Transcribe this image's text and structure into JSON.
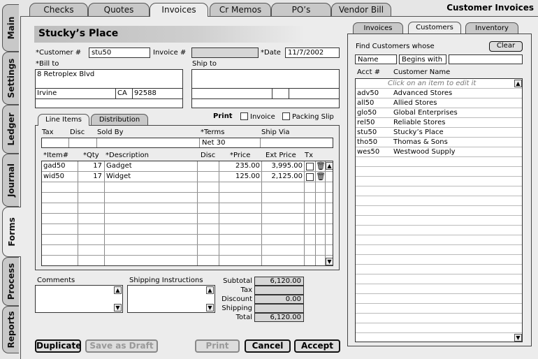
{
  "top_tabs": [
    {
      "label": "Checks"
    },
    {
      "label": "Quotes"
    },
    {
      "label": "Invoices"
    },
    {
      "label": "Cr Memos"
    },
    {
      "label": "PO’s"
    },
    {
      "label": "Vendor Bill"
    }
  ],
  "window_title": "Customer Invoices",
  "side_tabs": [
    {
      "label": "Main"
    },
    {
      "label": "Settings"
    },
    {
      "label": "Ledger"
    },
    {
      "label": "Journal"
    },
    {
      "label": "Forms"
    },
    {
      "label": "Process"
    },
    {
      "label": "Reports"
    }
  ],
  "header": {
    "customer_name": "Stucky’s Place"
  },
  "form": {
    "customer_label": "*Customer #",
    "customer_value": "stu50",
    "invoice_label": "Invoice #",
    "invoice_value": "",
    "date_label": "*Date",
    "date_value": "11/7/2002",
    "bill_to_label": "*Bill to",
    "bill_to": {
      "line1": "8 Retroplex Blvd",
      "city": "Irvine",
      "state": "CA",
      "zip": "92588"
    },
    "ship_to_label": "Ship to"
  },
  "line_tabs": [
    {
      "label": "Line Items"
    },
    {
      "label": "Distribution"
    }
  ],
  "print": {
    "label": "Print",
    "invoice": "Invoice",
    "packing_slip": "Packing Slip"
  },
  "terms_headers": {
    "tax": "Tax",
    "disc": "Disc",
    "sold_by": "Sold By",
    "terms": "*Terms",
    "ship_via": "Ship Via"
  },
  "terms_values": {
    "terms": "Net 30"
  },
  "items": {
    "headers": {
      "item": "*Item#",
      "qty": "*Qty",
      "desc": "*Description",
      "disc": "Disc",
      "price": "*Price",
      "ext": "Ext Price",
      "tx": "Tx"
    },
    "rows": [
      {
        "item": "gad50",
        "qty": "17",
        "desc": "Gadget",
        "price": "235.00",
        "ext": "3,995.00"
      },
      {
        "item": "wid50",
        "qty": "17",
        "desc": "Widget",
        "price": "125.00",
        "ext": "2,125.00"
      }
    ]
  },
  "comments_label": "Comments",
  "shipping_label": "Shipping Instructions",
  "totals": {
    "subtotal_label": "Subtotal",
    "subtotal": "6,120.00",
    "tax_label": "Tax",
    "tax": "",
    "discount_label": "Discount",
    "discount": "0.00",
    "shipping_label": "Shipping",
    "shipping": "",
    "total_label": "Total",
    "total": "6,120.00"
  },
  "buttons": {
    "duplicate": "Duplicate",
    "save_draft": "Save as Draft",
    "print": "Print",
    "cancel": "Cancel",
    "accept": "Accept"
  },
  "right_tabs": [
    {
      "label": "Invoices"
    },
    {
      "label": "Customers"
    },
    {
      "label": "Inventory"
    }
  ],
  "finder": {
    "title": "Find Customers whose",
    "clear": "Clear",
    "field": "Name",
    "op": "Begins with",
    "value": "",
    "col_acct": "Acct #",
    "col_name": "Customer Name",
    "hint": "Click on an item to edit it",
    "customers": [
      {
        "acct": "adv50",
        "name": "Advanced Stores"
      },
      {
        "acct": "all50",
        "name": "Allied Stores"
      },
      {
        "acct": "glo50",
        "name": "Global Enterprises"
      },
      {
        "acct": "rel50",
        "name": "Reliable Stores"
      },
      {
        "acct": "stu50",
        "name": "Stucky’s Place"
      },
      {
        "acct": "tho50",
        "name": "Thomas & Sons"
      },
      {
        "acct": "wes50",
        "name": "Westwood Supply"
      }
    ]
  }
}
